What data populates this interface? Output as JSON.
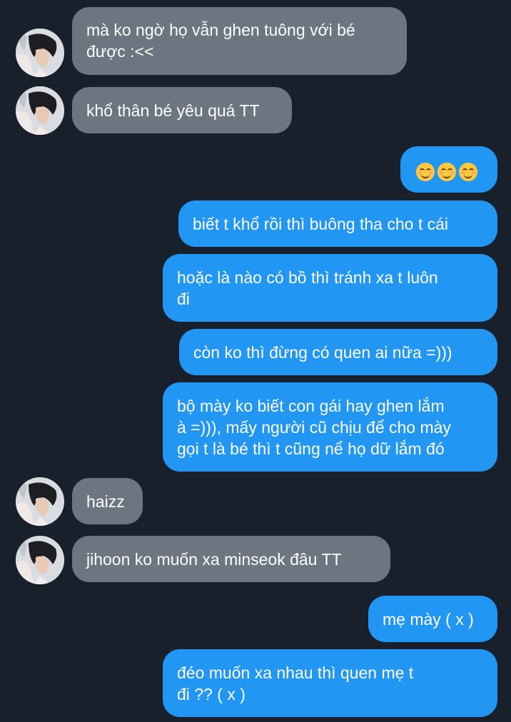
{
  "colors": {
    "background": "#18212b",
    "incoming_bubble": "#6b7680",
    "outgoing_bubble": "#2296f3",
    "text": "#ffffff"
  },
  "messages": [
    {
      "side": "in",
      "text": "mà ko ngờ họ vẫn ghen tuông với bé\nđược :<<"
    },
    {
      "side": "in",
      "text": "khổ thân bé yêu quá TT"
    },
    {
      "side": "out",
      "emoji": [
        "smiling-face-icon",
        "smiling-face-icon",
        "smiling-face-icon"
      ]
    },
    {
      "side": "out",
      "text": "biết t khổ rồi thì buông tha cho t cái"
    },
    {
      "side": "out",
      "text": "hoặc là nào có bồ thì tránh xa t luôn\nđi"
    },
    {
      "side": "out",
      "text": "còn ko thì đừng có quen ai nữa =)))"
    },
    {
      "side": "out",
      "text": "bộ mày ko biết con gái hay ghen lắm\nà =))), mấy người cũ chịu để cho mày\ngọi t là bé thì t cũng nể họ dữ lắm đó"
    },
    {
      "side": "in",
      "text": "haizz"
    },
    {
      "side": "in",
      "text": "jihoon ko muốn xa minseok đâu TT"
    },
    {
      "side": "out",
      "text": "mẹ mày ( x )"
    },
    {
      "side": "out",
      "text": "đéo muốn xa nhau thì quen mẹ t\nđi ?? ( x )"
    }
  ]
}
